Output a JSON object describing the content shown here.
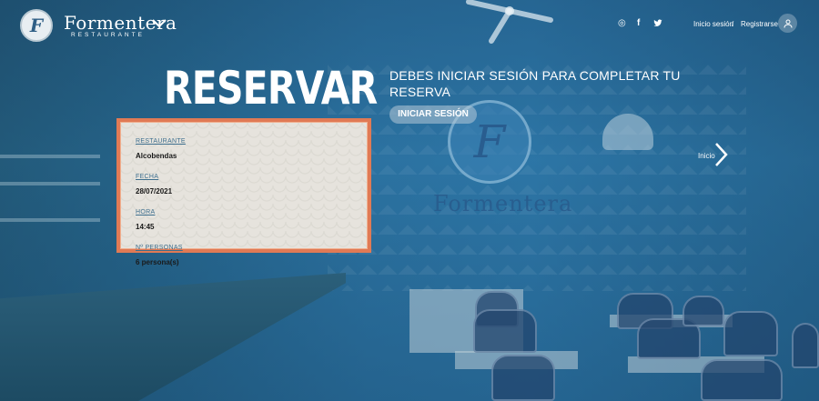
{
  "header": {
    "logo_letter": "F",
    "brand_name": "Formentera",
    "brand_subtitle": "RESTAURANTE",
    "social": {
      "instagram_glyph": "◎",
      "facebook_glyph": "f",
      "twitter_glyph": "🐦"
    },
    "login_label": "Inicio sesión",
    "separator": "/",
    "register_label": "Registrarse"
  },
  "reservation": {
    "title": "RESERVAR",
    "fields": [
      {
        "label": "RESTAURANTE",
        "value": "Alcobendas"
      },
      {
        "label": "FECHA",
        "value": "28/07/2021"
      },
      {
        "label": "HORA",
        "value": "14:45"
      },
      {
        "label": "Nº PERSONAS",
        "value": "6 persona(s)"
      }
    ],
    "login_notice": "DEBES INICIAR SESIÓN PARA COMPLETAR TU RESERVA",
    "login_button": "INICIAR SESIÓN"
  },
  "background": {
    "sign_letter": "F",
    "sign_word": "Formentera"
  },
  "carousel": {
    "next_label": "Inicio"
  },
  "colors": {
    "card_border": "#e07a55",
    "card_bg": "#e6e3dd",
    "label_blue": "#3e6f8e",
    "overlay_blue": "#2f6d8e"
  }
}
